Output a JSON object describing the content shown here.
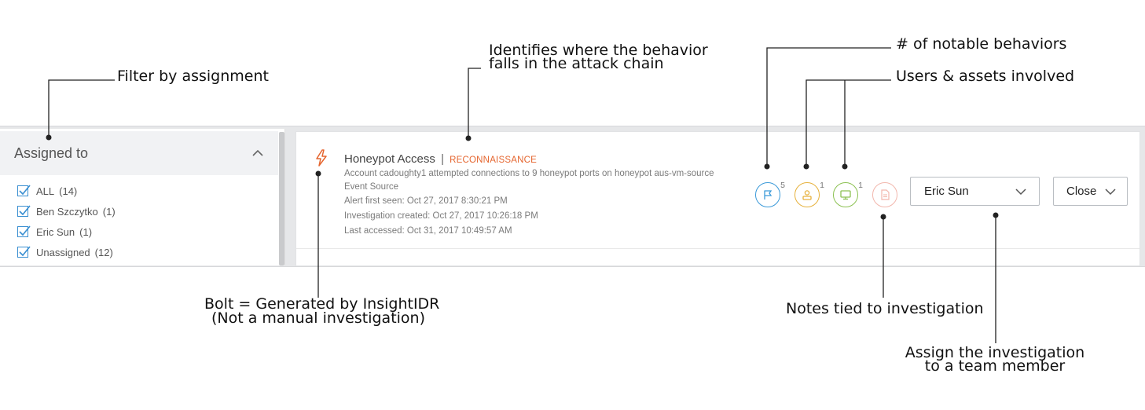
{
  "annotations": {
    "filter_by_assignment": "Filter by assignment",
    "attack_chain_line1": "Identifies where the behavior",
    "attack_chain_line2": "falls in the attack chain",
    "notable_behaviors": "# of notable behaviors",
    "users_assets": "Users & assets involved",
    "bolt_line1": "Bolt = Generated by InsightIDR",
    "bolt_line2": "(Not a manual investigation)",
    "notes_tied": "Notes tied to investigation",
    "assign_line1": "Assign the investigation",
    "assign_line2": "to a team member"
  },
  "filter": {
    "title": "Assigned to",
    "items": [
      {
        "label": "ALL",
        "count": "(14)",
        "checked": true
      },
      {
        "label": "Ben Szczytko",
        "count": "(1)",
        "checked": true
      },
      {
        "label": "Eric Sun",
        "count": "(1)",
        "checked": true
      },
      {
        "label": "Unassigned",
        "count": "(12)",
        "checked": true
      }
    ]
  },
  "investigation": {
    "title": "Honeypot Access",
    "separator": "|",
    "phase": "RECONNAISSANCE",
    "description": "Account cadoughty1 attempted connections to 9 honeypot ports on honeypot aus-vm-source",
    "source": "Event Source",
    "alert_first_seen": "Alert first seen: Oct 27, 2017 8:30:21 PM",
    "created": "Investigation created: Oct 27, 2017 10:26:18 PM",
    "last_accessed": "Last accessed: Oct 31, 2017 10:49:57 AM",
    "behaviors_count": "5",
    "users_count": "1",
    "assets_count": "1",
    "assignee": "Eric Sun",
    "status_button": "Close",
    "colors": {
      "phase": "#e5652e",
      "behaviors": "#3b9ad9",
      "users": "#e6b13c",
      "assets": "#8cc152",
      "notes": "#f2b7ad",
      "checkbox": "#3a8fd1"
    },
    "icons": {
      "bolt": "bolt-icon",
      "behaviors": "flag-icon",
      "users": "user-icon",
      "assets": "monitor-icon",
      "notes": "document-icon"
    }
  }
}
